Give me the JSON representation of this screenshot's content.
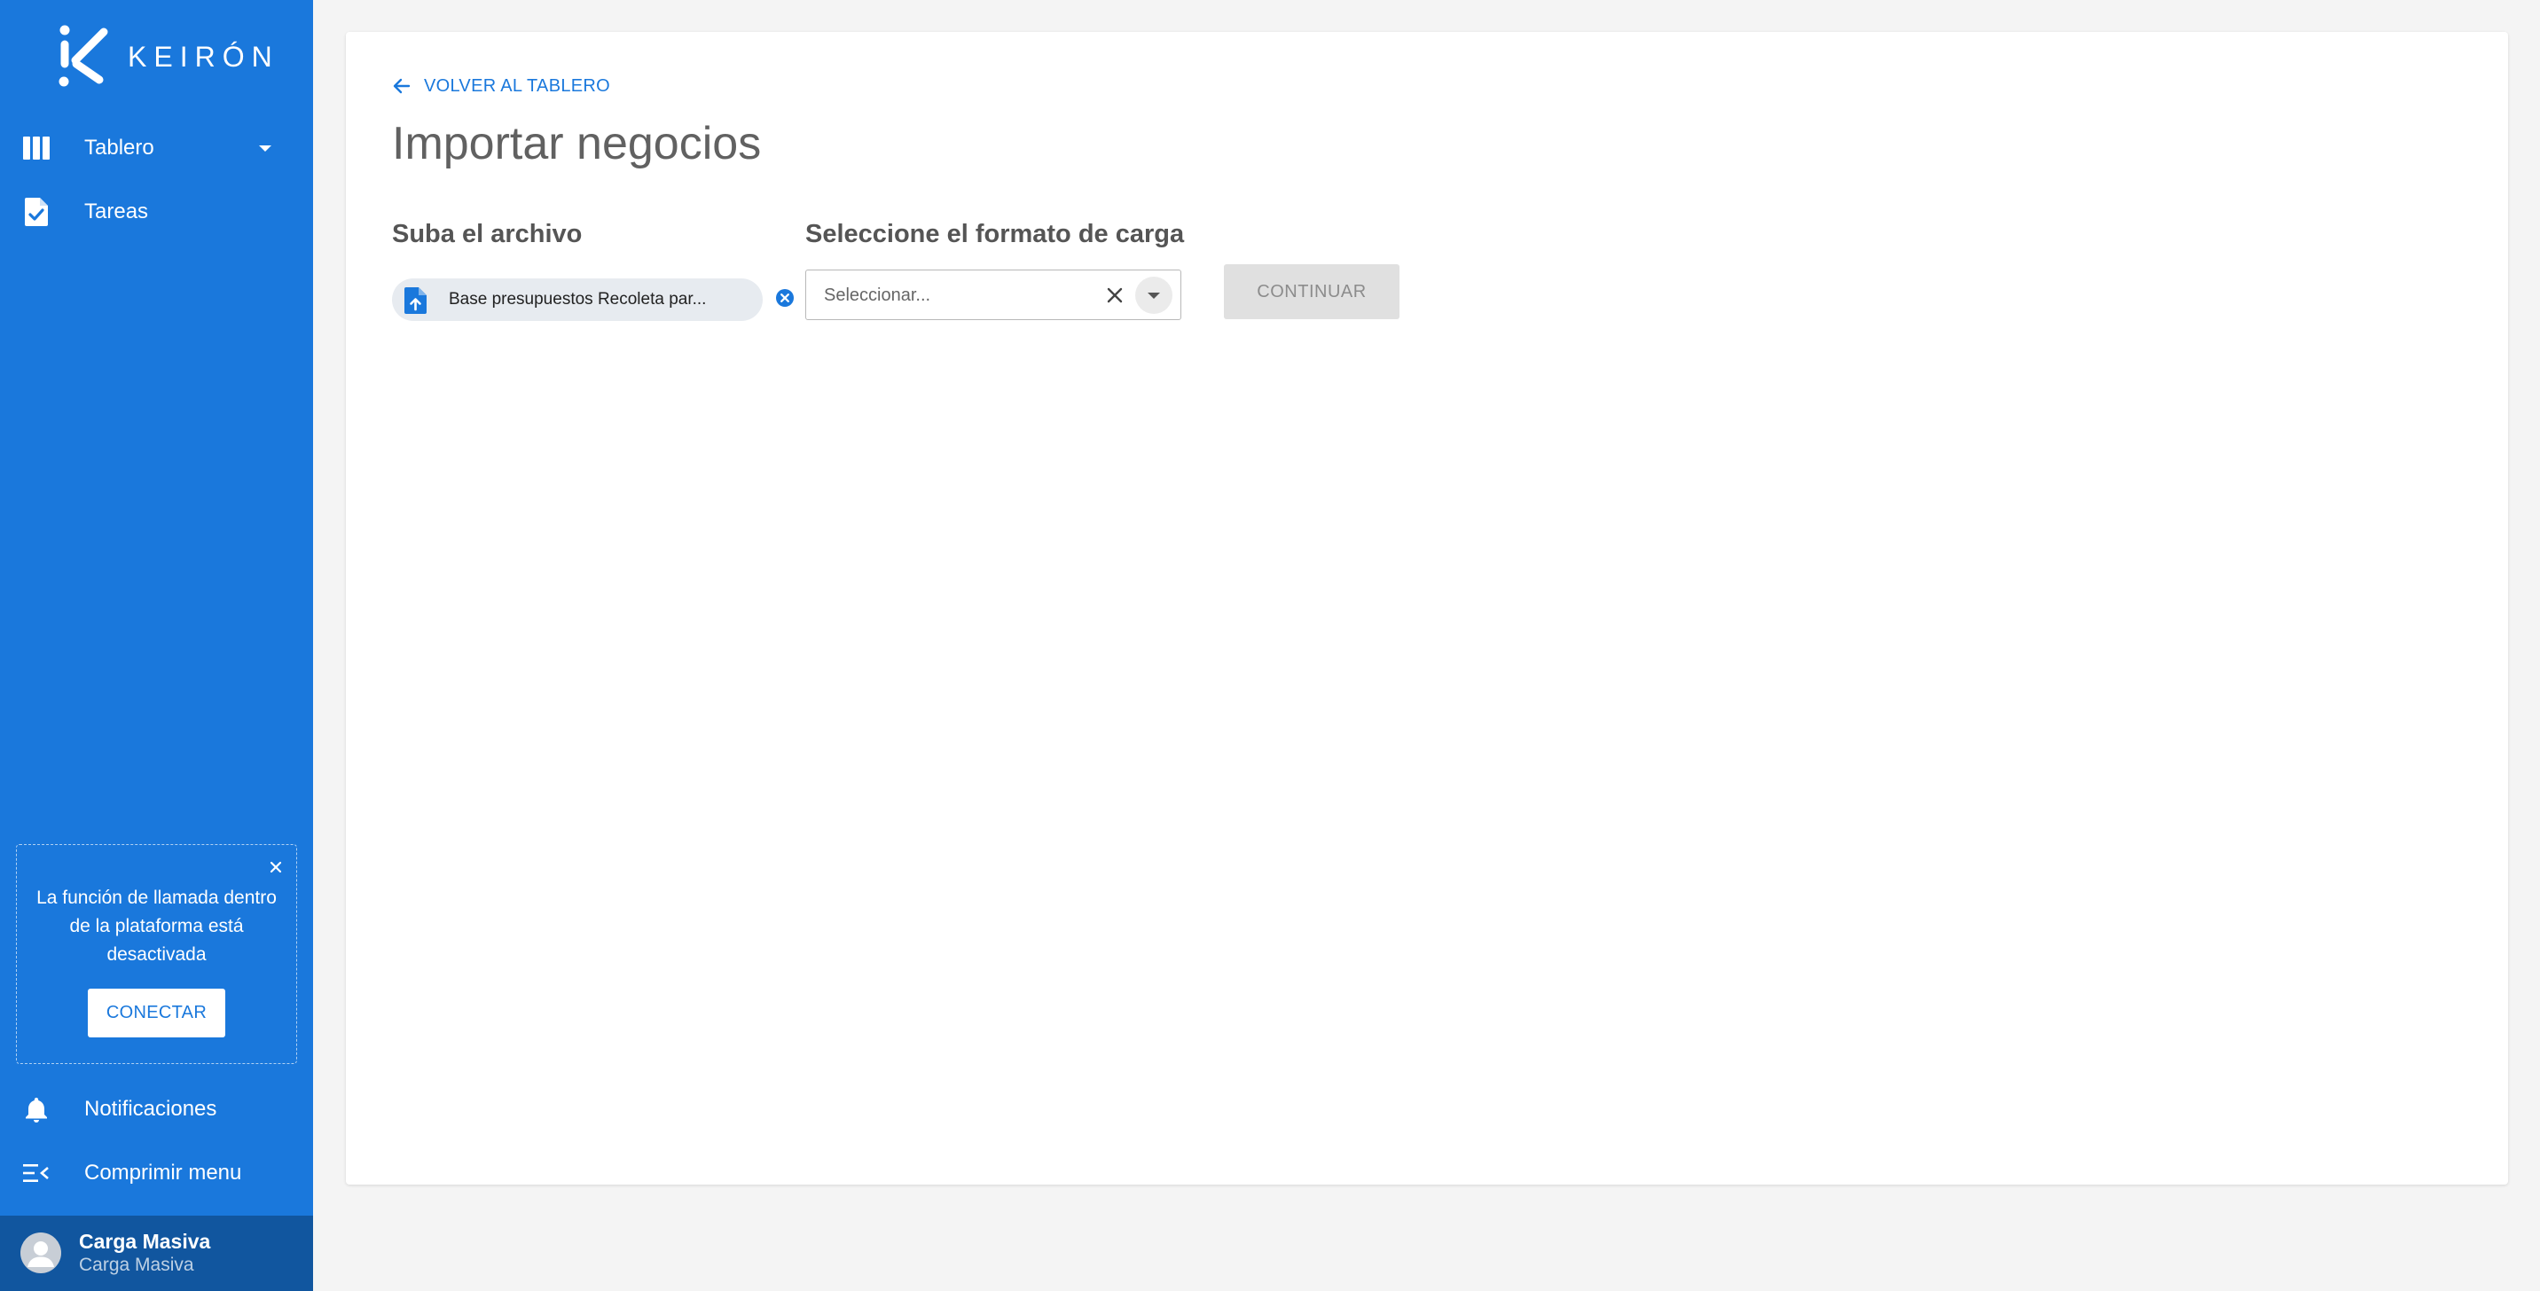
{
  "brand": {
    "name": "KEIRÓN",
    "accent_color": "#1a78dc",
    "sidebar_color": "#1a78dc",
    "user_bar_color": "#11569f"
  },
  "sidebar": {
    "items": [
      {
        "label": "Tablero",
        "icon": "columns-icon",
        "has_dropdown": true
      },
      {
        "label": "Tareas",
        "icon": "task-file-icon",
        "has_dropdown": false
      }
    ],
    "call_notice": {
      "message": "La función de llamada dentro de la plataforma está desactivada",
      "button_label": "CONECTAR",
      "close_icon": "close-icon"
    },
    "bottom_items": [
      {
        "label": "Notificaciones",
        "icon": "bell-icon"
      },
      {
        "label": "Comprimir menu",
        "icon": "collapse-menu-icon"
      }
    ],
    "user": {
      "name": "Carga Masiva",
      "subtitle": "Carga Masiva",
      "icon": "avatar-icon"
    }
  },
  "main": {
    "back_link": "VOLVER AL TABLERO",
    "title": "Importar negocios",
    "upload": {
      "label": "Suba el archivo",
      "file_name": "Base presupuestos Recoleta par...",
      "file_icon": "file-upload-icon",
      "remove_icon": "remove-circle-icon"
    },
    "format": {
      "label": "Seleccione el formato de carga",
      "placeholder": "Seleccionar...",
      "clear_icon": "clear-icon",
      "dropdown_icon": "chevron-down-icon"
    },
    "continue_button": "CONTINUAR"
  }
}
